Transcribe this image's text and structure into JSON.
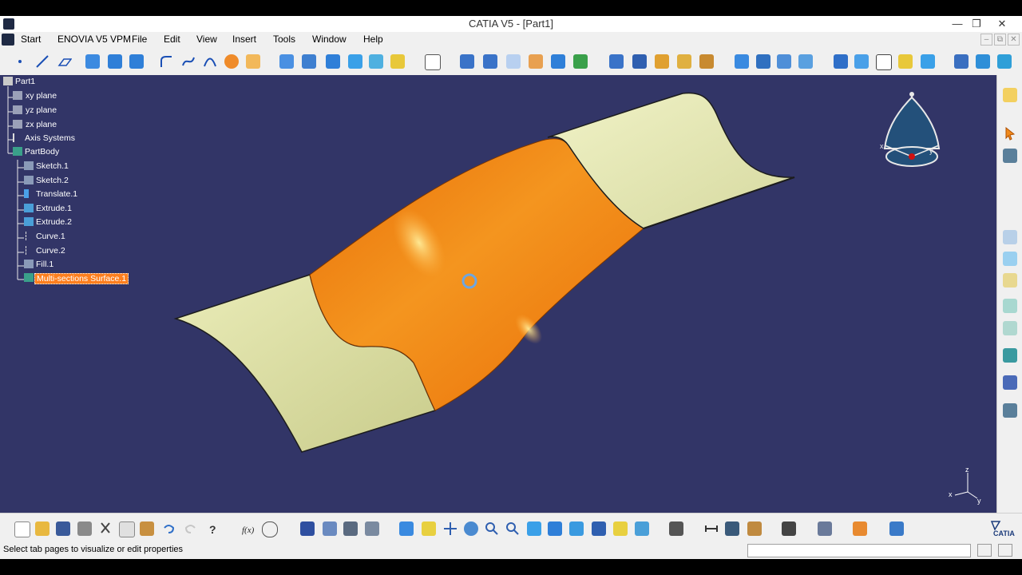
{
  "window": {
    "title": "CATIA V5 - [Part1]",
    "controls": [
      "—",
      "❐",
      "✕"
    ],
    "mdi_controls": [
      "–",
      "⧉",
      "✕"
    ]
  },
  "menu": {
    "items": [
      "Start",
      "ENOVIA V5 VPM",
      "File",
      "Edit",
      "View",
      "Insert",
      "Tools",
      "Window",
      "Help"
    ]
  },
  "tree": {
    "root": "Part1",
    "items": [
      {
        "label": "xy plane",
        "icon": "plane-icon"
      },
      {
        "label": "yz plane",
        "icon": "plane-icon"
      },
      {
        "label": "zx plane",
        "icon": "plane-icon"
      },
      {
        "label": "Axis Systems",
        "icon": "axis-systems-icon"
      },
      {
        "label": "PartBody",
        "icon": "partbody-icon"
      },
      {
        "label": "Sketch.1",
        "icon": "sketch-icon"
      },
      {
        "label": "Sketch.2",
        "icon": "sketch-icon"
      },
      {
        "label": "Translate.1",
        "icon": "translate-icon"
      },
      {
        "label": "Extrude.1",
        "icon": "extrude-icon"
      },
      {
        "label": "Extrude.2",
        "icon": "extrude-icon"
      },
      {
        "label": "Curve.1",
        "icon": "curve-icon"
      },
      {
        "label": "Curve.2",
        "icon": "curve-icon"
      },
      {
        "label": "Fill.1",
        "icon": "fill-icon"
      },
      {
        "label": "Multi-sections Surface.1",
        "icon": "multi-sections-surface-icon",
        "selected": true
      }
    ]
  },
  "compass": {
    "x": "x",
    "y": "y"
  },
  "axis_triad": {
    "x": "x",
    "y": "y",
    "z": "z"
  },
  "status": {
    "text": "Select tab pages to visualize or edit properties",
    "command_input": ""
  },
  "logo": {
    "text": "CATIA"
  },
  "colors": {
    "viewport_bg": "#323567",
    "surface_light": "#e3e6a8",
    "surface_selected": "#f08a1c",
    "selection_highlight": "#ff7f1e"
  }
}
